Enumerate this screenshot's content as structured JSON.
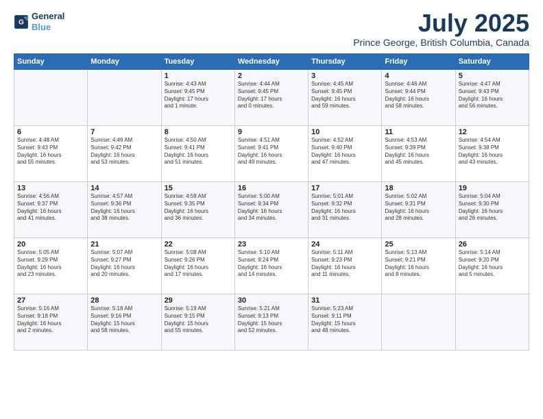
{
  "logo": {
    "line1": "General",
    "line2": "Blue"
  },
  "title": "July 2025",
  "subtitle": "Prince George, British Columbia, Canada",
  "days_header": [
    "Sunday",
    "Monday",
    "Tuesday",
    "Wednesday",
    "Thursday",
    "Friday",
    "Saturday"
  ],
  "weeks": [
    [
      {
        "num": "",
        "info": ""
      },
      {
        "num": "",
        "info": ""
      },
      {
        "num": "1",
        "info": "Sunrise: 4:43 AM\nSunset: 9:45 PM\nDaylight: 17 hours\nand 1 minute."
      },
      {
        "num": "2",
        "info": "Sunrise: 4:44 AM\nSunset: 9:45 PM\nDaylight: 17 hours\nand 0 minutes."
      },
      {
        "num": "3",
        "info": "Sunrise: 4:45 AM\nSunset: 9:45 PM\nDaylight: 16 hours\nand 59 minutes."
      },
      {
        "num": "4",
        "info": "Sunrise: 4:46 AM\nSunset: 9:44 PM\nDaylight: 16 hours\nand 58 minutes."
      },
      {
        "num": "5",
        "info": "Sunrise: 4:47 AM\nSunset: 9:43 PM\nDaylight: 16 hours\nand 56 minutes."
      }
    ],
    [
      {
        "num": "6",
        "info": "Sunrise: 4:48 AM\nSunset: 9:43 PM\nDaylight: 16 hours\nand 55 minutes."
      },
      {
        "num": "7",
        "info": "Sunrise: 4:49 AM\nSunset: 9:42 PM\nDaylight: 16 hours\nand 53 minutes."
      },
      {
        "num": "8",
        "info": "Sunrise: 4:50 AM\nSunset: 9:41 PM\nDaylight: 16 hours\nand 51 minutes."
      },
      {
        "num": "9",
        "info": "Sunrise: 4:51 AM\nSunset: 9:41 PM\nDaylight: 16 hours\nand 49 minutes."
      },
      {
        "num": "10",
        "info": "Sunrise: 4:52 AM\nSunset: 9:40 PM\nDaylight: 16 hours\nand 47 minutes."
      },
      {
        "num": "11",
        "info": "Sunrise: 4:53 AM\nSunset: 9:39 PM\nDaylight: 16 hours\nand 45 minutes."
      },
      {
        "num": "12",
        "info": "Sunrise: 4:54 AM\nSunset: 9:38 PM\nDaylight: 16 hours\nand 43 minutes."
      }
    ],
    [
      {
        "num": "13",
        "info": "Sunrise: 4:56 AM\nSunset: 9:37 PM\nDaylight: 16 hours\nand 41 minutes."
      },
      {
        "num": "14",
        "info": "Sunrise: 4:57 AM\nSunset: 9:36 PM\nDaylight: 16 hours\nand 38 minutes."
      },
      {
        "num": "15",
        "info": "Sunrise: 4:58 AM\nSunset: 9:35 PM\nDaylight: 16 hours\nand 36 minutes."
      },
      {
        "num": "16",
        "info": "Sunrise: 5:00 AM\nSunset: 9:34 PM\nDaylight: 16 hours\nand 34 minutes."
      },
      {
        "num": "17",
        "info": "Sunrise: 5:01 AM\nSunset: 9:32 PM\nDaylight: 16 hours\nand 31 minutes."
      },
      {
        "num": "18",
        "info": "Sunrise: 5:02 AM\nSunset: 9:31 PM\nDaylight: 16 hours\nand 28 minutes."
      },
      {
        "num": "19",
        "info": "Sunrise: 5:04 AM\nSunset: 9:30 PM\nDaylight: 16 hours\nand 26 minutes."
      }
    ],
    [
      {
        "num": "20",
        "info": "Sunrise: 5:05 AM\nSunset: 9:29 PM\nDaylight: 16 hours\nand 23 minutes."
      },
      {
        "num": "21",
        "info": "Sunrise: 5:07 AM\nSunset: 9:27 PM\nDaylight: 16 hours\nand 20 minutes."
      },
      {
        "num": "22",
        "info": "Sunrise: 5:08 AM\nSunset: 9:26 PM\nDaylight: 16 hours\nand 17 minutes."
      },
      {
        "num": "23",
        "info": "Sunrise: 5:10 AM\nSunset: 9:24 PM\nDaylight: 16 hours\nand 14 minutes."
      },
      {
        "num": "24",
        "info": "Sunrise: 5:11 AM\nSunset: 9:23 PM\nDaylight: 16 hours\nand 11 minutes."
      },
      {
        "num": "25",
        "info": "Sunrise: 5:13 AM\nSunset: 9:21 PM\nDaylight: 16 hours\nand 8 minutes."
      },
      {
        "num": "26",
        "info": "Sunrise: 5:14 AM\nSunset: 9:20 PM\nDaylight: 16 hours\nand 5 minutes."
      }
    ],
    [
      {
        "num": "27",
        "info": "Sunrise: 5:16 AM\nSunset: 9:18 PM\nDaylight: 16 hours\nand 2 minutes."
      },
      {
        "num": "28",
        "info": "Sunrise: 5:18 AM\nSunset: 9:16 PM\nDaylight: 15 hours\nand 58 minutes."
      },
      {
        "num": "29",
        "info": "Sunrise: 5:19 AM\nSunset: 9:15 PM\nDaylight: 15 hours\nand 55 minutes."
      },
      {
        "num": "30",
        "info": "Sunrise: 5:21 AM\nSunset: 9:13 PM\nDaylight: 15 hours\nand 52 minutes."
      },
      {
        "num": "31",
        "info": "Sunrise: 5:23 AM\nSunset: 9:11 PM\nDaylight: 15 hours\nand 48 minutes."
      },
      {
        "num": "",
        "info": ""
      },
      {
        "num": "",
        "info": ""
      }
    ]
  ]
}
